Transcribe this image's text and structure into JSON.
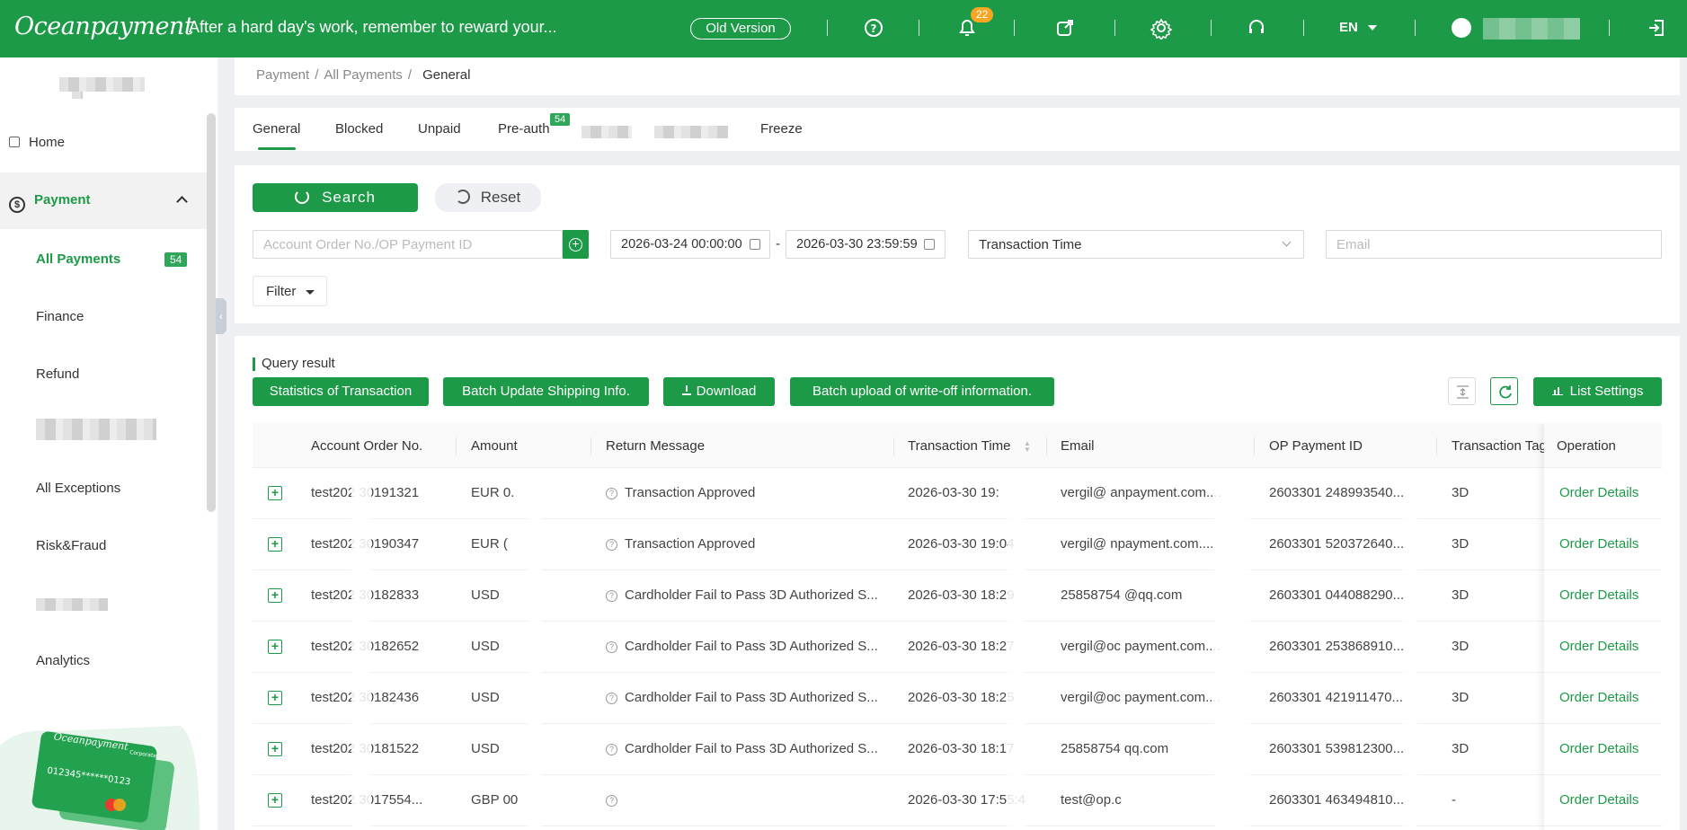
{
  "topbar": {
    "logo": "Oceanpayment",
    "slogan": "After a hard day's work, remember to reward your...",
    "old_version": "Old Version",
    "notification_count": "22",
    "language": "EN"
  },
  "sidebar": {
    "home": "Home",
    "payment": "Payment",
    "items": [
      "All Payments",
      "Finance",
      "Refund",
      "All Exceptions",
      "Risk&Fraud",
      "Analytics"
    ],
    "all_payments_badge": "54",
    "card_brand": "Oceanpayment",
    "card_number": "012345******0123",
    "card_tier": "Corporate"
  },
  "breadcrumb": {
    "l1": "Payment",
    "l2": "All Payments",
    "l3": "General"
  },
  "tabs": [
    "General",
    "Blocked",
    "Unpaid",
    "Pre-auth",
    "Freeze"
  ],
  "preauth_badge": "54",
  "search": {
    "search_label": "Search",
    "reset_label": "Reset",
    "order_placeholder": "Account Order No./OP Payment ID",
    "date_from": "2026-03-24 00:00:00",
    "date_sep": "-",
    "date_to": "2026-03-30 23:59:59",
    "time_type": "Transaction Time",
    "email_placeholder": "Email",
    "filter": "Filter"
  },
  "result": {
    "title": "Query result",
    "btn_stats": "Statistics of Transaction",
    "btn_batch_shipping": "Batch Update Shipping Info.",
    "btn_download": "Download",
    "btn_writeoff": "Batch upload of write-off information.",
    "btn_list_settings": "List Settings"
  },
  "table": {
    "headers": [
      "Account Order No.",
      "Amount",
      "Return Message",
      "Transaction Time",
      "Email",
      "OP Payment ID",
      "Transaction Tag",
      "Operation"
    ],
    "rows": [
      {
        "order": "test202   30191321",
        "amount": "EUR 0.",
        "message": "Transaction Approved",
        "time": "2026-03-30 19:",
        "email": "vergil@     anpayment.com....",
        "op_id": "2603301     248993540...",
        "tag": "3D",
        "op": "Order Details"
      },
      {
        "order": "test202   30190347",
        "amount": "EUR (",
        "message": "Transaction Approved",
        "time": "2026-03-30 19:04",
        "email": "vergil@     npayment.com....",
        "op_id": "2603301     520372640...",
        "tag": "3D",
        "op": "Order Details"
      },
      {
        "order": "test202   30182833",
        "amount": "USD",
        "message": "Cardholder Fail to Pass 3D Authorized S...",
        "time": "2026-03-30 18:29",
        "email": "25858754     @qq.com",
        "op_id": "2603301     044088290...",
        "tag": "3D",
        "op": "Order Details"
      },
      {
        "order": "test202   30182652",
        "amount": "USD",
        "message": "Cardholder Fail to Pass 3D Authorized S...",
        "time": "2026-03-30 18:27",
        "email": "vergil@oc     payment.com....",
        "op_id": "2603301     253868910...",
        "tag": "3D",
        "op": "Order Details"
      },
      {
        "order": "test202   30182436",
        "amount": "USD",
        "message": "Cardholder Fail to Pass 3D Authorized S...",
        "time": "2026-03-30 18:25",
        "email": "vergil@oc     payment.com....",
        "op_id": "2603301     421911470...",
        "tag": "3D",
        "op": "Order Details"
      },
      {
        "order": "test202   30181522",
        "amount": "USD",
        "message": "Cardholder Fail to Pass 3D Authorized S...",
        "time": "2026-03-30 18:17",
        "email": "25858754     qq.com",
        "op_id": "2603301     539812300...",
        "tag": "3D",
        "op": "Order Details"
      },
      {
        "order": "test202   3017554...",
        "amount": "GBP      00",
        "message": "",
        "time": "2026-03-30 17:55:4",
        "email": "test@op.c",
        "op_id": "2603301     463494810...",
        "tag": "-",
        "op": "Order Details"
      }
    ]
  },
  "colors": {
    "brand": "#1d9a48",
    "badge": "#f5a623"
  }
}
